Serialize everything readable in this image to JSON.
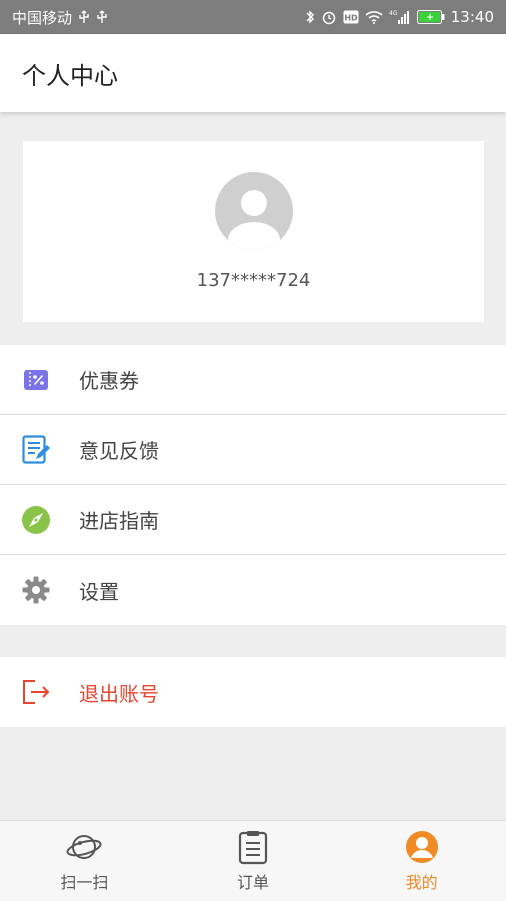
{
  "status_bar": {
    "carrier": "中国移动",
    "time": "13:40",
    "network": "4G"
  },
  "header": {
    "title": "个人中心"
  },
  "profile": {
    "phone": "137*****724"
  },
  "menu": {
    "items": [
      {
        "label": "优惠券",
        "icon": "coupon-icon",
        "color": "#7a74e6"
      },
      {
        "label": "意见反馈",
        "icon": "feedback-icon",
        "color": "#2f8de0"
      },
      {
        "label": "进店指南",
        "icon": "compass-icon",
        "color": "#8ac34a"
      },
      {
        "label": "设置",
        "icon": "gear-icon",
        "color": "#8a8a8a"
      }
    ]
  },
  "logout": {
    "label": "退出账号",
    "icon": "logout-icon",
    "color": "#e8452e"
  },
  "tabbar": {
    "tabs": [
      {
        "label": "扫一扫",
        "icon": "planet-icon",
        "active": false
      },
      {
        "label": "订单",
        "icon": "clipboard-icon",
        "active": false
      },
      {
        "label": "我的",
        "icon": "user-icon",
        "active": true
      }
    ],
    "active_color": "#f08a24"
  }
}
